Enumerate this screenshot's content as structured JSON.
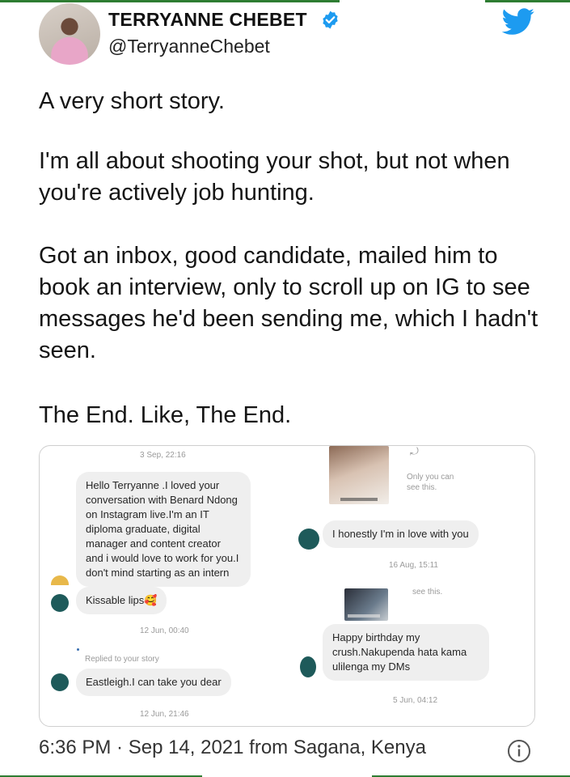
{
  "author": {
    "name": "TERRYANNE CHEBET",
    "handle": "@TerryanneChebet",
    "avatar_icon": "profile-photo",
    "verified_icon": "verified-badge-icon",
    "brand_icon": "twitter-bird-icon",
    "brand_color": "#1d9bf0"
  },
  "tweet": {
    "paragraphs": [
      "A very short story.",
      "I'm all about shooting your shot, but not when you're actively job hunting.",
      "Got an inbox,  good candidate, mailed him to book an interview, only to scroll up on IG to see messages he'd been sending me, which I hadn't seen.",
      "The End. Like, The End."
    ]
  },
  "screenshot": {
    "left": {
      "ts1": "3 Sep, 22:16",
      "msg1": "Hello Terryanne .I loved your conversation with Benard Ndong on Instagram live.I'm an IT diploma graduate, digital manager and content creator and i would love to work for you.I don't mind starting as an intern",
      "msg2": "Kissable lips🥰",
      "ts2": "12 Jun, 00:40",
      "replied": "Replied to your story",
      "msg3": "Eastleigh.I can take you dear",
      "ts3": "12 Jun, 21:46"
    },
    "right": {
      "only_you": "Only you can see this.",
      "msg1": "I honestly I'm in love with you",
      "ts1": "16 Aug, 15:11",
      "see_this": "see this.",
      "msg2": "Happy birthday my crush.Nakupenda hata kama ulilenga my DMs",
      "ts2": "5 Jun, 04:12"
    }
  },
  "footer": {
    "meta": "6:36 PM · Sep 14, 2021 from Sagana, Kenya",
    "info_icon": "info-icon"
  },
  "colors": {
    "accent": "#1d9bf0",
    "avatar_dot": "#1e5a5a"
  }
}
